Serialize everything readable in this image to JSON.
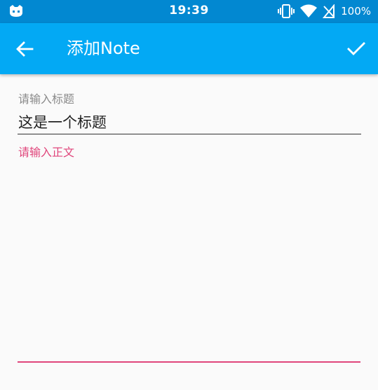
{
  "status_bar": {
    "time": "19:39",
    "battery_text": "100%",
    "icons": [
      "cyanogen-android-icon",
      "vibrate-icon",
      "wifi-icon",
      "no-signal-icon"
    ]
  },
  "app_bar": {
    "title": "添加Note",
    "back_icon": "arrow-back-icon",
    "confirm_icon": "check-icon",
    "color": "#03a9f4"
  },
  "form": {
    "title_label": "请输入标题",
    "title_value": "这是一个标题",
    "body_label": "请输入正文",
    "body_value": ""
  },
  "colors": {
    "status_bar": "#0288d1",
    "accent": "#e0457b"
  }
}
